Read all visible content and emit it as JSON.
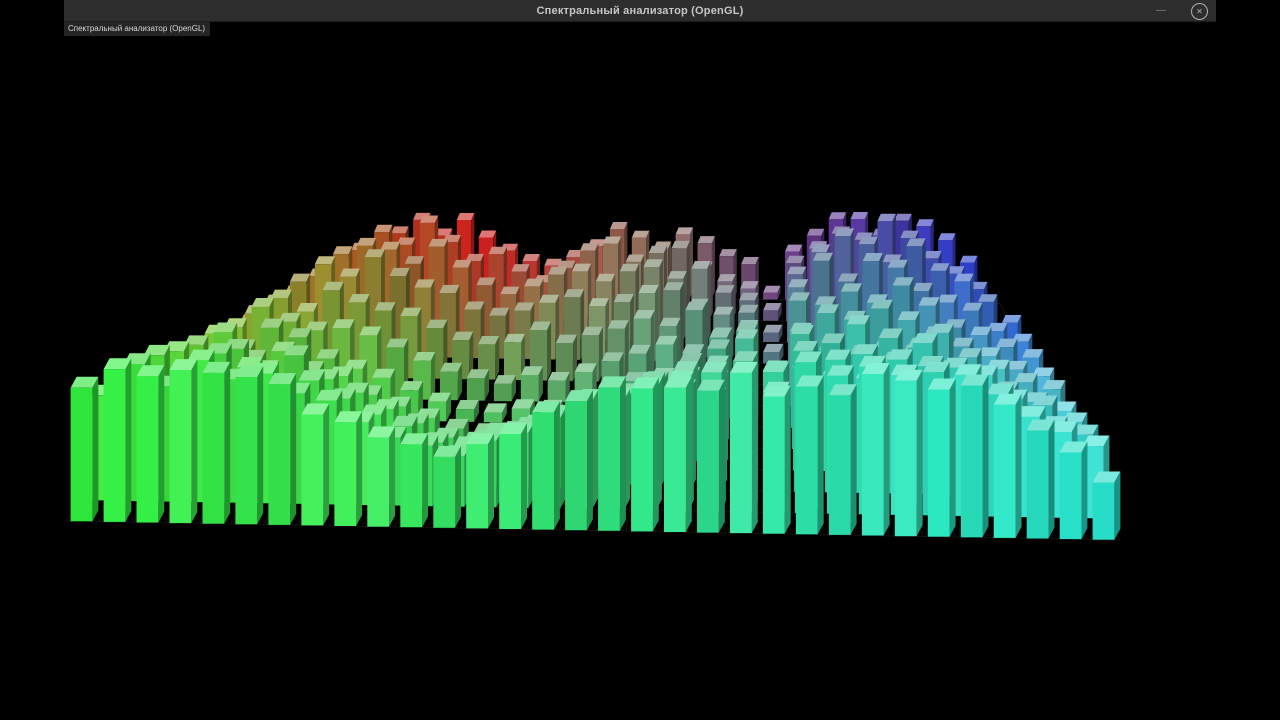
{
  "window": {
    "title": "Спектральный анализатор (OpenGL)",
    "viewport_caption": "Спектральный анализатор (OpenGL)",
    "icons": {
      "close": "✕",
      "minimize": "—"
    },
    "colors": {
      "titlebar_bg": "#2d2d2d",
      "title_text": "#c6c6c6",
      "background": "#000000"
    }
  },
  "visualization": {
    "type": "3d-bar-spectrum",
    "rows": 12,
    "cols": 32,
    "palette": {
      "back": [
        "#cc6a24",
        "#e02020",
        "#a08068",
        "#6e3aa0",
        "#2644e4"
      ],
      "mid": [
        "#86c832",
        "#4ecb4e",
        "#5cb47e",
        "#3cbca6",
        "#52c2da"
      ],
      "front": [
        "#2ff03e",
        "#3bf055",
        "#31e87e",
        "#2de8b6",
        "#29e8d2"
      ]
    },
    "heights": [
      [
        0,
        0,
        26,
        38,
        52,
        60,
        46,
        64,
        50,
        38,
        30,
        26,
        34,
        42,
        55,
        48,
        40,
        52,
        44,
        36,
        28,
        6,
        40,
        55,
        64,
        70,
        58,
        72,
        62,
        50,
        36,
        0
      ],
      [
        0,
        22,
        36,
        52,
        66,
        58,
        70,
        56,
        42,
        50,
        36,
        28,
        40,
        52,
        60,
        46,
        52,
        58,
        40,
        33,
        26,
        8,
        48,
        62,
        76,
        68,
        80,
        66,
        56,
        43,
        28,
        0
      ],
      [
        16,
        30,
        43,
        60,
        73,
        66,
        56,
        68,
        53,
        40,
        33,
        40,
        48,
        56,
        43,
        50,
        58,
        46,
        53,
        38,
        30,
        7,
        55,
        70,
        83,
        74,
        66,
        78,
        60,
        48,
        33,
        18
      ],
      [
        23,
        38,
        53,
        68,
        60,
        73,
        63,
        53,
        46,
        38,
        30,
        34,
        42,
        50,
        38,
        44,
        52,
        56,
        42,
        34,
        40,
        8,
        60,
        73,
        66,
        78,
        70,
        58,
        50,
        40,
        28,
        20
      ],
      [
        28,
        43,
        56,
        50,
        64,
        58,
        48,
        42,
        36,
        28,
        24,
        28,
        36,
        28,
        32,
        40,
        48,
        42,
        50,
        36,
        43,
        10,
        63,
        56,
        68,
        62,
        72,
        56,
        46,
        38,
        30,
        23
      ],
      [
        33,
        48,
        60,
        56,
        46,
        52,
        42,
        34,
        26,
        20,
        16,
        12,
        18,
        14,
        22,
        28,
        36,
        44,
        38,
        46,
        52,
        9,
        54,
        66,
        58,
        70,
        62,
        53,
        44,
        36,
        28,
        24
      ],
      [
        40,
        53,
        46,
        60,
        52,
        44,
        36,
        28,
        20,
        14,
        9,
        7,
        10,
        9,
        14,
        20,
        28,
        34,
        42,
        50,
        56,
        11,
        62,
        56,
        68,
        60,
        54,
        64,
        50,
        42,
        34,
        28
      ],
      [
        46,
        58,
        68,
        54,
        62,
        48,
        40,
        32,
        24,
        16,
        10,
        7,
        9,
        12,
        18,
        26,
        34,
        42,
        48,
        56,
        50,
        12,
        56,
        68,
        62,
        74,
        66,
        56,
        48,
        42,
        36,
        30
      ],
      [
        53,
        66,
        58,
        72,
        56,
        64,
        50,
        42,
        34,
        26,
        18,
        14,
        20,
        26,
        32,
        40,
        48,
        56,
        62,
        54,
        66,
        60,
        72,
        64,
        76,
        68,
        80,
        70,
        60,
        50,
        42,
        34
      ],
      [
        60,
        73,
        66,
        78,
        68,
        58,
        64,
        52,
        44,
        36,
        28,
        24,
        32,
        38,
        46,
        54,
        60,
        68,
        62,
        74,
        68,
        78,
        72,
        82,
        74,
        86,
        76,
        68,
        60,
        52,
        44,
        38
      ],
      [
        68,
        80,
        74,
        86,
        76,
        82,
        70,
        60,
        52,
        44,
        36,
        32,
        40,
        48,
        56,
        62,
        70,
        76,
        82,
        72,
        84,
        76,
        86,
        78,
        88,
        82,
        90,
        80,
        72,
        62,
        52,
        44
      ],
      [
        76,
        88,
        82,
        92,
        84,
        90,
        78,
        68,
        60,
        52,
        46,
        44,
        52,
        60,
        66,
        74,
        80,
        86,
        90,
        80,
        92,
        84,
        93,
        86,
        94,
        88,
        93,
        84,
        76,
        66,
        54,
        32
      ]
    ]
  }
}
